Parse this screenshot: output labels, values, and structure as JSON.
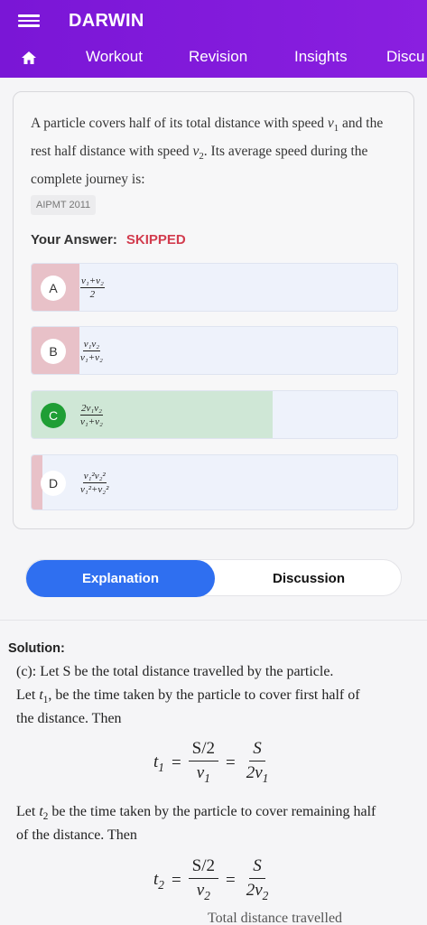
{
  "app": {
    "title": "DARWIN"
  },
  "nav": {
    "tabs": [
      "Workout",
      "Revision",
      "Insights",
      "Discu"
    ]
  },
  "question": {
    "text_prefix": "A particle covers half of its total distance with speed ",
    "v1": "v",
    "sub1": "1",
    "text_mid": " and the rest half distance with speed ",
    "sub2": "2",
    "text_suffix": ". Its average speed during the complete journey is:",
    "tag": "AIPMT 2011"
  },
  "answer": {
    "label": "Your Answer:",
    "value": "SKIPPED"
  },
  "options": [
    {
      "letter": "A",
      "num": "v₁+v₂",
      "den": "2",
      "fill_fraction": 0.13,
      "state": "wrong"
    },
    {
      "letter": "B",
      "num": "v₁v₂",
      "den": "v₁+v₂",
      "fill_fraction": 0.13,
      "state": "wrong"
    },
    {
      "letter": "C",
      "num": "2v₁v₂",
      "den": "v₁+v₂",
      "fill_fraction": 0.66,
      "state": "correct"
    },
    {
      "letter": "D",
      "num": "v₁²v₂²",
      "den": "v₁²+v₂²",
      "fill_fraction": 0.03,
      "state": "wrong"
    }
  ],
  "toggle": {
    "active": "Explanation",
    "inactive": "Discussion"
  },
  "solution": {
    "heading": "Solution:",
    "line1": "(c): Let S be the total distance travelled by the particle.",
    "line2a": "Let ",
    "line2b": ", be the time taken by the particle to cover first half of",
    "line3": "the distance. Then",
    "line4a": "Let ",
    "line4b": " be the time taken by the particle to cover remaining half",
    "line5": "of the distance. Then",
    "eq_num1": "S/2",
    "eq_num2": "S",
    "trailing": "Total distance travelled"
  },
  "colors": {
    "appbar": "#7a16d6",
    "accent_blue": "#2f6ff0",
    "skipped_red": "#d23c4e",
    "correct_green": "#1f9e35",
    "wrong_fill": "#e8c1c8",
    "correct_fill": "#cfe7d6"
  },
  "icons": [
    "menu-icon",
    "home-icon"
  ]
}
